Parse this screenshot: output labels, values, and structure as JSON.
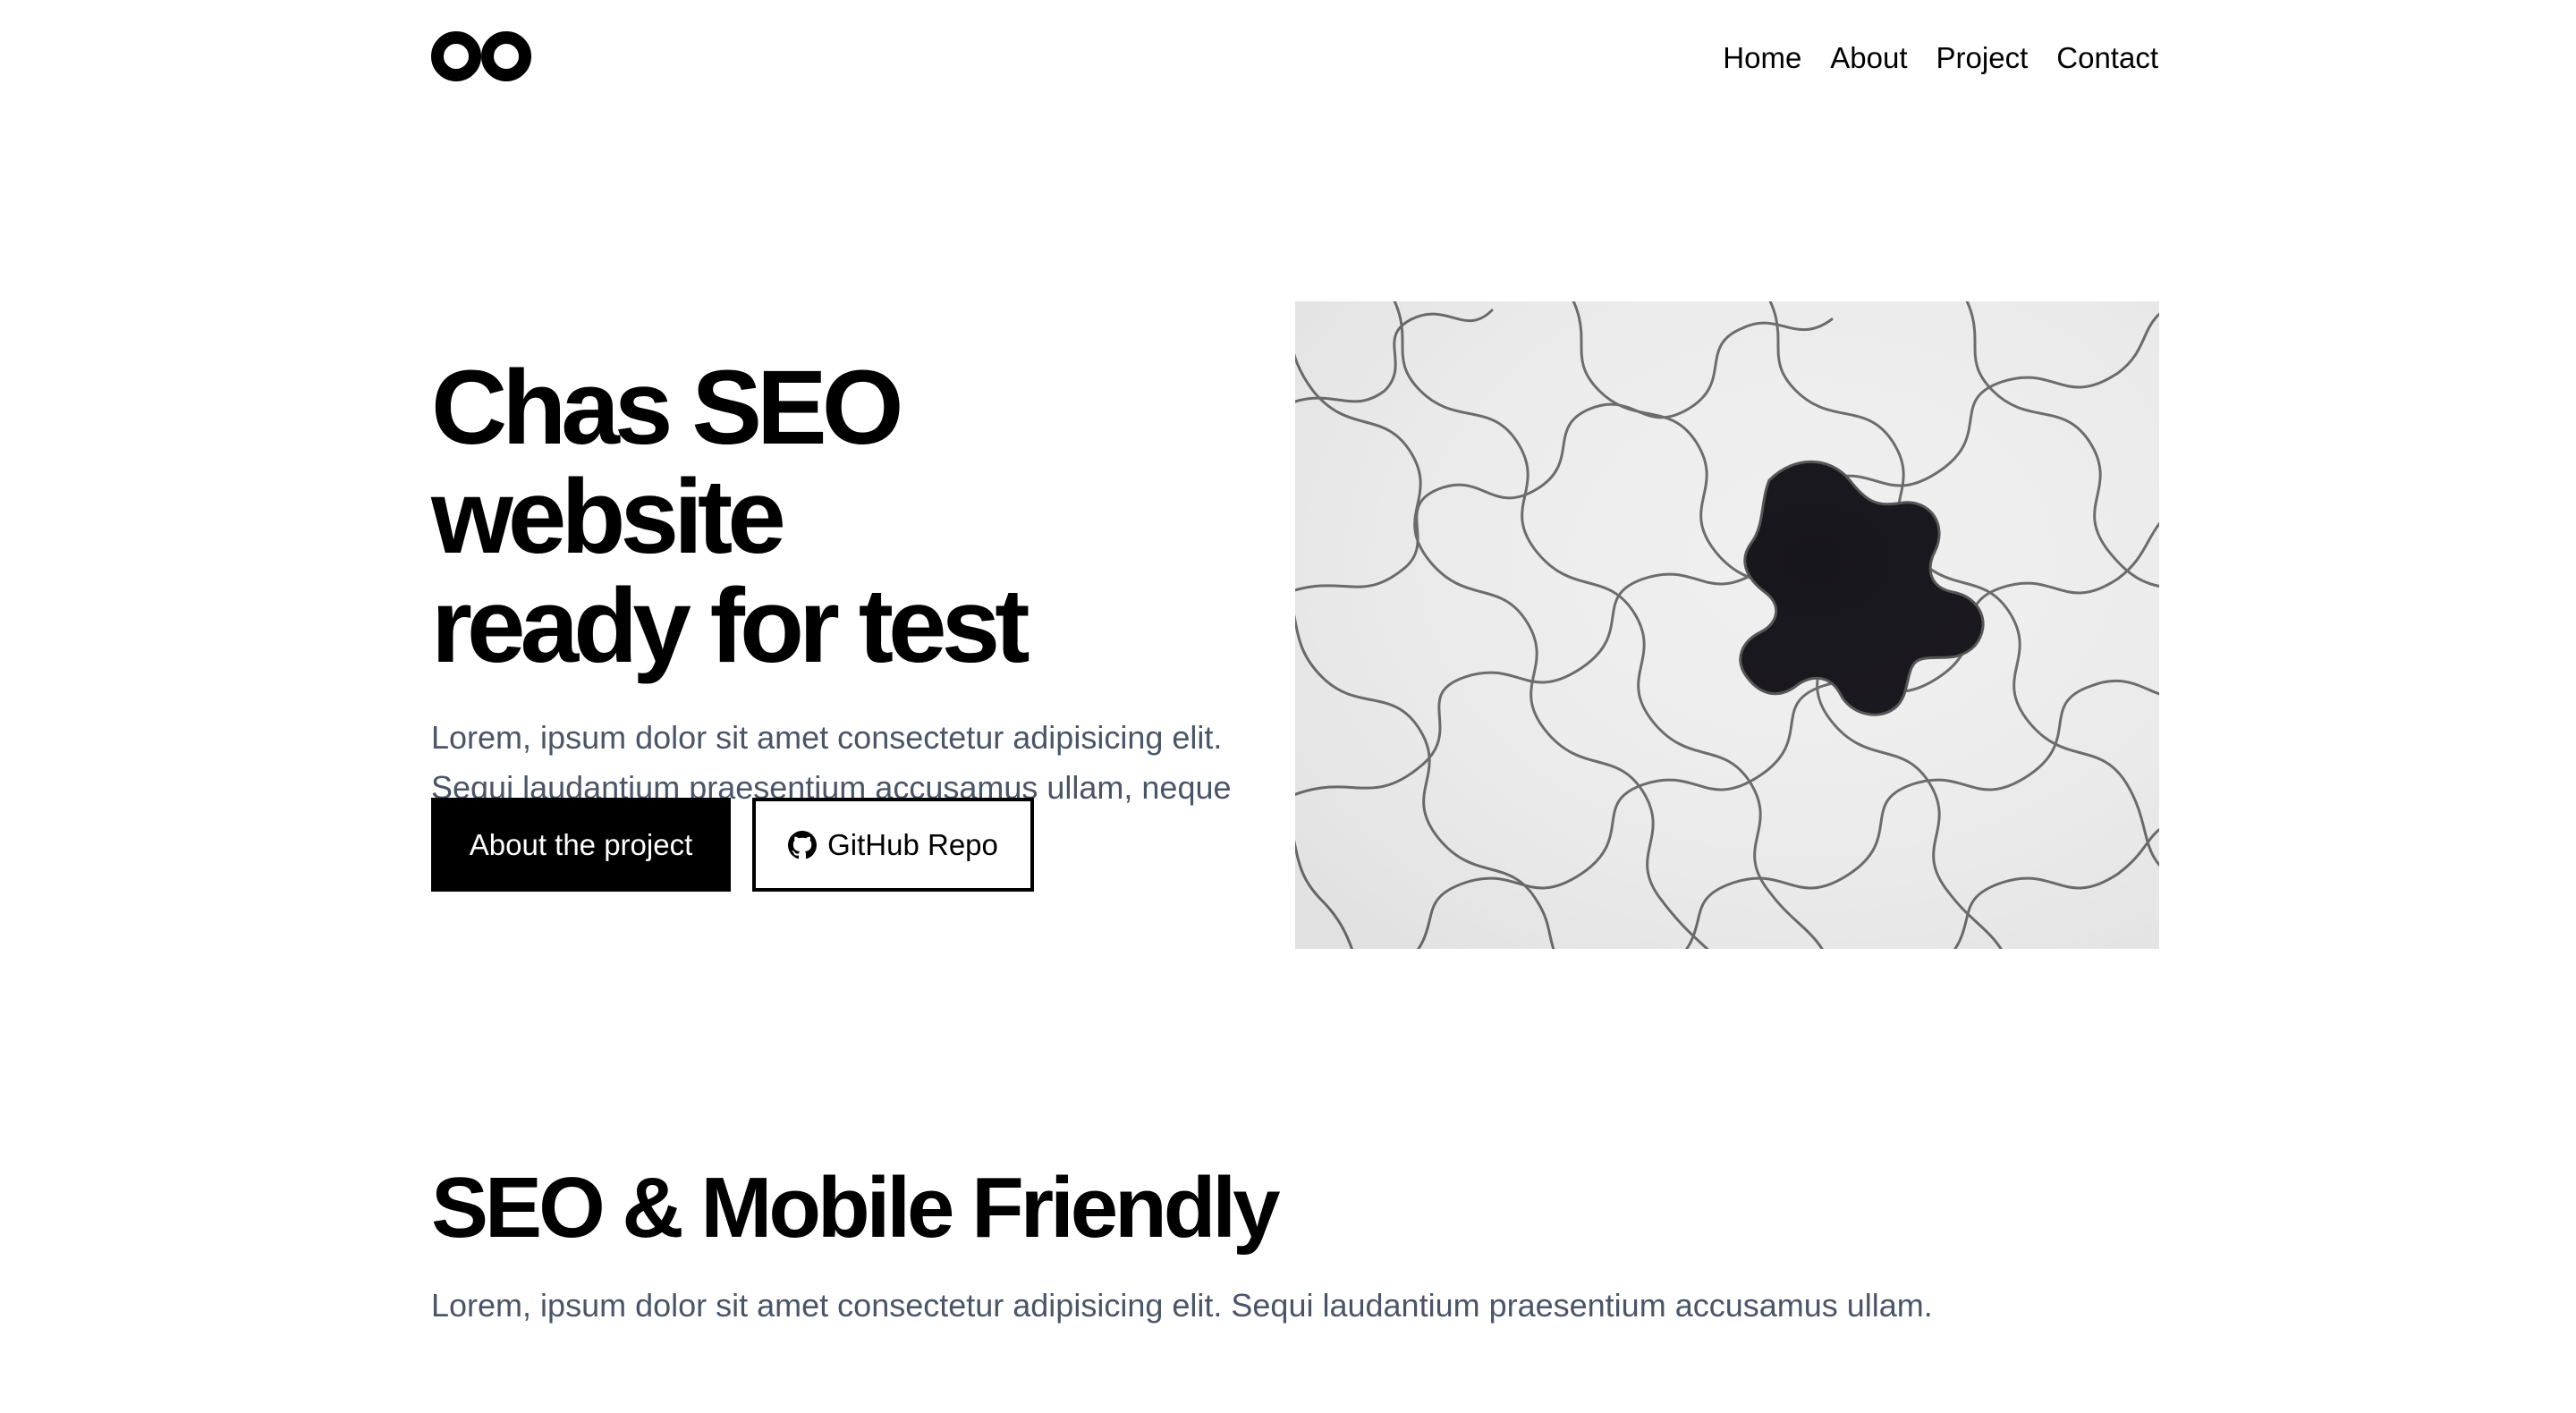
{
  "header": {
    "logo_icon": "infinity-logo-icon",
    "nav": [
      {
        "label": "Home"
      },
      {
        "label": "About"
      },
      {
        "label": "Project"
      },
      {
        "label": "Contact"
      }
    ]
  },
  "hero": {
    "title_line1": "Chas SEO website",
    "title_line2": "ready for test",
    "description": "Lorem, ipsum dolor sit amet consectetur adipisicing elit. Sequi laudantium praesentium accusamus ullam, neque nostrum.",
    "primary_button": "About the project",
    "secondary_button": "GitHub Repo",
    "secondary_button_icon": "github-icon",
    "image_icon": "puzzle-image"
  },
  "features": {
    "title": "SEO & Mobile Friendly",
    "description": "Lorem, ipsum dolor sit amet consectetur adipisicing elit. Sequi laudantium praesentium accusamus ullam."
  },
  "colors": {
    "text": "#000000",
    "muted_text": "#4a5568",
    "primary_button_bg": "#000000",
    "background": "#ffffff"
  }
}
